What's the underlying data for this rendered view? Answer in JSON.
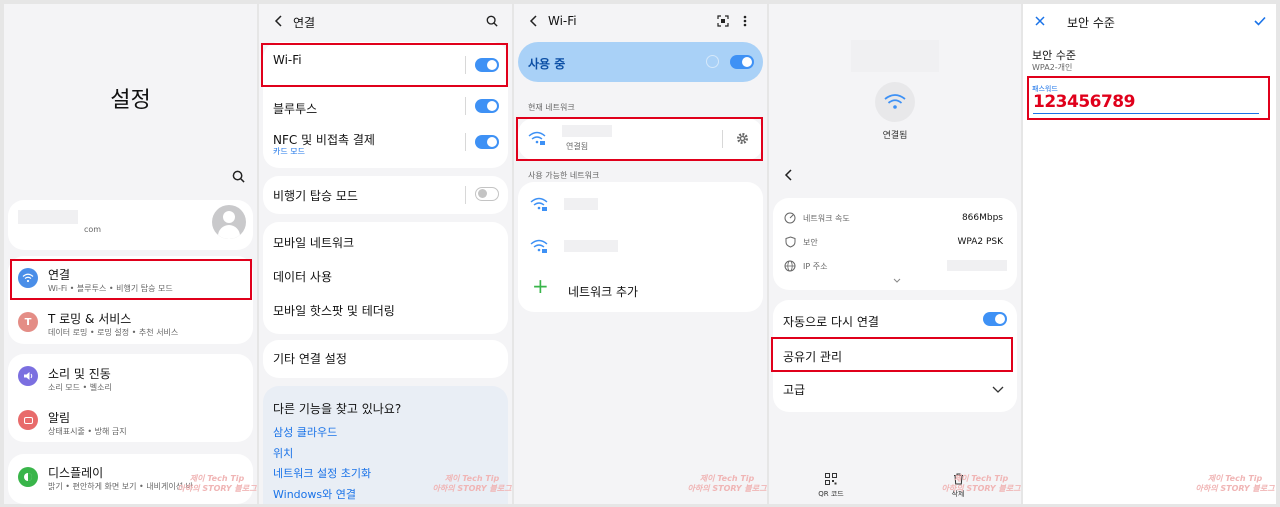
{
  "panel1": {
    "title": "설정",
    "account": {
      "email_suffix": "com"
    },
    "items": [
      {
        "label": "연결",
        "sub": "Wi-Fi • 블루투스 • 비행기 탑승 모드",
        "color": "#4a8ee8",
        "icon": "wifi-icon"
      },
      {
        "label": "T 로밍 & 서비스",
        "sub": "데이터 로밍 • 로밍 설정 • 추천 서비스",
        "color": "#e48d86",
        "icon": "roaming-icon"
      },
      {
        "label": "소리 및 진동",
        "sub": "소리 모드 • 벨소리",
        "color": "#7b6fe0",
        "icon": "volume-icon"
      },
      {
        "label": "알림",
        "sub": "상태표시줄 • 방해 금지",
        "color": "#e86b6b",
        "icon": "notification-icon"
      },
      {
        "label": "디스플레이",
        "sub": "밝기 • 편안하게 화면 보기 • 내비게이션 바",
        "color": "#39b54a",
        "icon": "display-icon"
      }
    ]
  },
  "panel2": {
    "title": "연결",
    "wifi": "Wi-Fi",
    "bluetooth": "블루투스",
    "nfc": "NFC 및 비접촉 결제",
    "nfc_sub": "카드 모드",
    "airplane": "비행기 탑승 모드",
    "mobile_network": "모바일 네트워크",
    "data_usage": "데이터 사용",
    "hotspot": "모바일 핫스팟 및 테더링",
    "more": "기타 연결 설정",
    "looking_title": "다른 기능을 찾고 있나요?",
    "links": [
      "삼성 클라우드",
      "위치",
      "네트워크 설정 초기화",
      "Windows와 연결"
    ]
  },
  "panel3": {
    "title": "Wi-Fi",
    "in_use": "사용 중",
    "current_network": "현재 네트워크",
    "connected": "연결됨",
    "available_networks": "사용 가능한 네트워크",
    "add_network": "네트워크 추가"
  },
  "panel4": {
    "connected": "연결됨",
    "speed_label": "네트워크 속도",
    "speed_value": "866Mbps",
    "security_label": "보안",
    "security_value": "WPA2 PSK",
    "ip_label": "IP 주소",
    "auto_reconnect": "자동으로 다시 연결",
    "router_manage": "공유기 관리",
    "advanced": "고급",
    "qr_label": "QR 코드",
    "delete_label": "삭제"
  },
  "panel5": {
    "title": "보안 수준",
    "security_level": "보안 수준",
    "security_level_value": "WPA2-개인",
    "password_label": "패스워드",
    "password_value": "123456789"
  },
  "watermark": {
    "line1": "제이 Tech Tip",
    "line2": "아하의 STORY 블로그"
  },
  "colors": {
    "accent": "#3e91f5",
    "highlight": "#e0001b",
    "wifi_card": "#a9d1f7"
  }
}
